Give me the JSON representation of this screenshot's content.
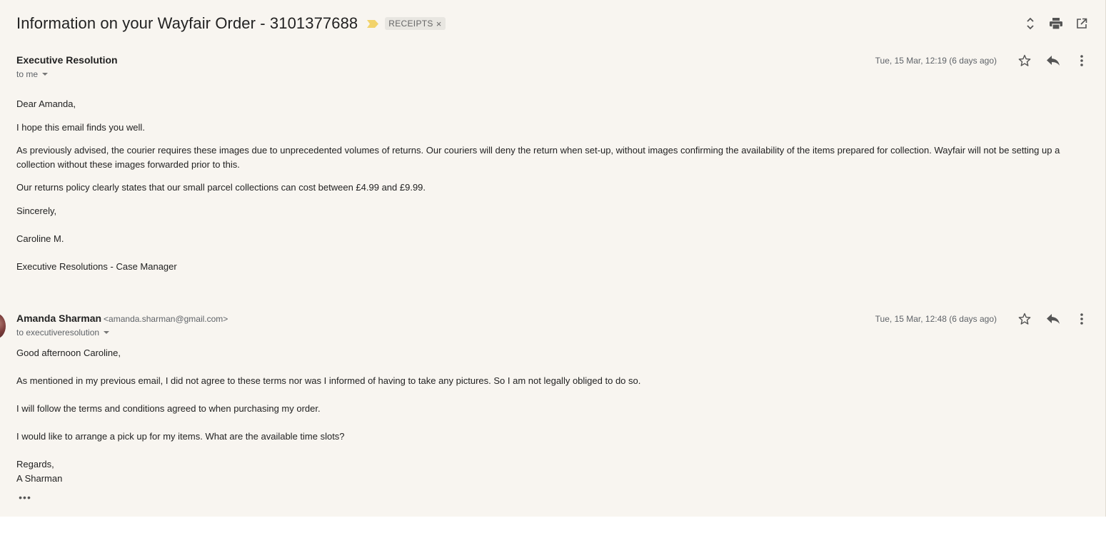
{
  "subject": "Information on your Wayfair Order - 3101377688",
  "label": "RECEIPTS",
  "label_remove": "×",
  "colors": {
    "importance": "#f2d36b",
    "background": "#f8f5f0"
  },
  "top_actions": [
    "expand-collapse-icon",
    "print-icon",
    "open-in-new-window-icon"
  ],
  "messages": [
    {
      "sender_name": "Executive Resolution",
      "recipient": "to me",
      "date": "Tue, 15 Mar, 12:19 (6 days ago)",
      "paragraphs": [
        "Dear Amanda,",
        "I hope this email finds you well.",
        "As previously advised, the courier requires these images due to unprecedented volumes of returns. Our couriers will deny the return when set-up, without images confirming the availability of the items prepared for collection. Wayfair will not be setting up a collection without these images forwarded prior to this.",
        "Our returns policy clearly states that our small parcel collections can cost between £4.99 and £9.99.",
        "Sincerely,",
        "Caroline M.",
        "Executive Resolutions - Case Manager"
      ]
    },
    {
      "sender_name": "Amanda Sharman",
      "sender_email": "<amanda.sharman@gmail.com>",
      "recipient": "to executiveresolution",
      "date": "Tue, 15 Mar, 12:48 (6 days ago)",
      "paragraphs": [
        "Good afternoon Caroline,",
        "As mentioned in my previous email, I did not agree to these terms nor was I informed of having to take any pictures. So I am not legally obliged to do so.",
        "I will follow the terms and conditions agreed to when purchasing my order.",
        "I would like to arrange a pick up for my items. What are the available time slots?",
        "Regards,",
        "A Sharman"
      ],
      "trimmed_content": "•••"
    }
  ]
}
